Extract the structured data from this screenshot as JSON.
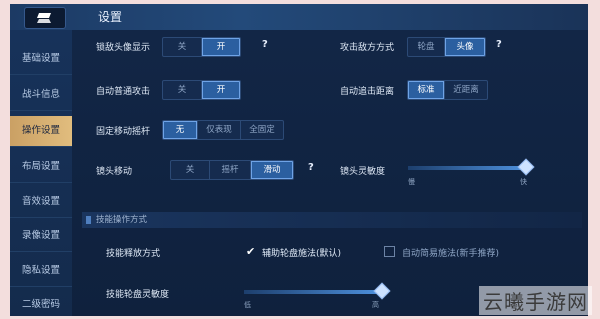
{
  "header": {
    "title": "设置"
  },
  "sidebar": {
    "items": [
      {
        "label": "基础设置",
        "active": false
      },
      {
        "label": "战斗信息",
        "active": false
      },
      {
        "label": "操作设置",
        "active": true
      },
      {
        "label": "布局设置",
        "active": false
      },
      {
        "label": "音效设置",
        "active": false
      },
      {
        "label": "录像设置",
        "active": false
      },
      {
        "label": "隐私设置",
        "active": false
      },
      {
        "label": "二级密码",
        "active": false
      }
    ]
  },
  "settings": {
    "enemy_avatar": {
      "label": "锁敌头像显示",
      "options": [
        "关",
        "开"
      ],
      "selected": "开",
      "help": "?"
    },
    "attack_target": {
      "label": "攻击敌方方式",
      "options": [
        "轮盘",
        "头像"
      ],
      "selected": "头像",
      "help": "?"
    },
    "auto_attack": {
      "label": "自动普通攻击",
      "options": [
        "关",
        "开"
      ],
      "selected": "开"
    },
    "auto_chase": {
      "label": "自动追击距离",
      "options": [
        "标准",
        "近距离"
      ],
      "selected": "标准"
    },
    "fixed_joystick": {
      "label": "固定移动摇杆",
      "options": [
        "无",
        "仅表现",
        "全固定"
      ],
      "selected": "无"
    },
    "camera_move": {
      "label": "镜头移动",
      "options": [
        "关",
        "摇杆",
        "滑动"
      ],
      "selected": "滑动",
      "help": "?"
    },
    "camera_sensitivity": {
      "label": "镜头灵敏度",
      "min_label": "慢",
      "max_label": "快",
      "value": 1.0
    },
    "skill_section": {
      "title": "技能操作方式"
    },
    "skill_release": {
      "label": "技能释放方式",
      "option_a": "辅助轮盘施法(默认)",
      "option_a_checked": true,
      "option_b": "自动简易施法(新手推荐)",
      "option_b_checked": false
    },
    "skill_wheel_sensitivity": {
      "label": "技能轮盘灵敏度",
      "min_label": "低",
      "max_label": "高",
      "value": 1.0
    }
  },
  "watermark": "云曦手游网"
}
